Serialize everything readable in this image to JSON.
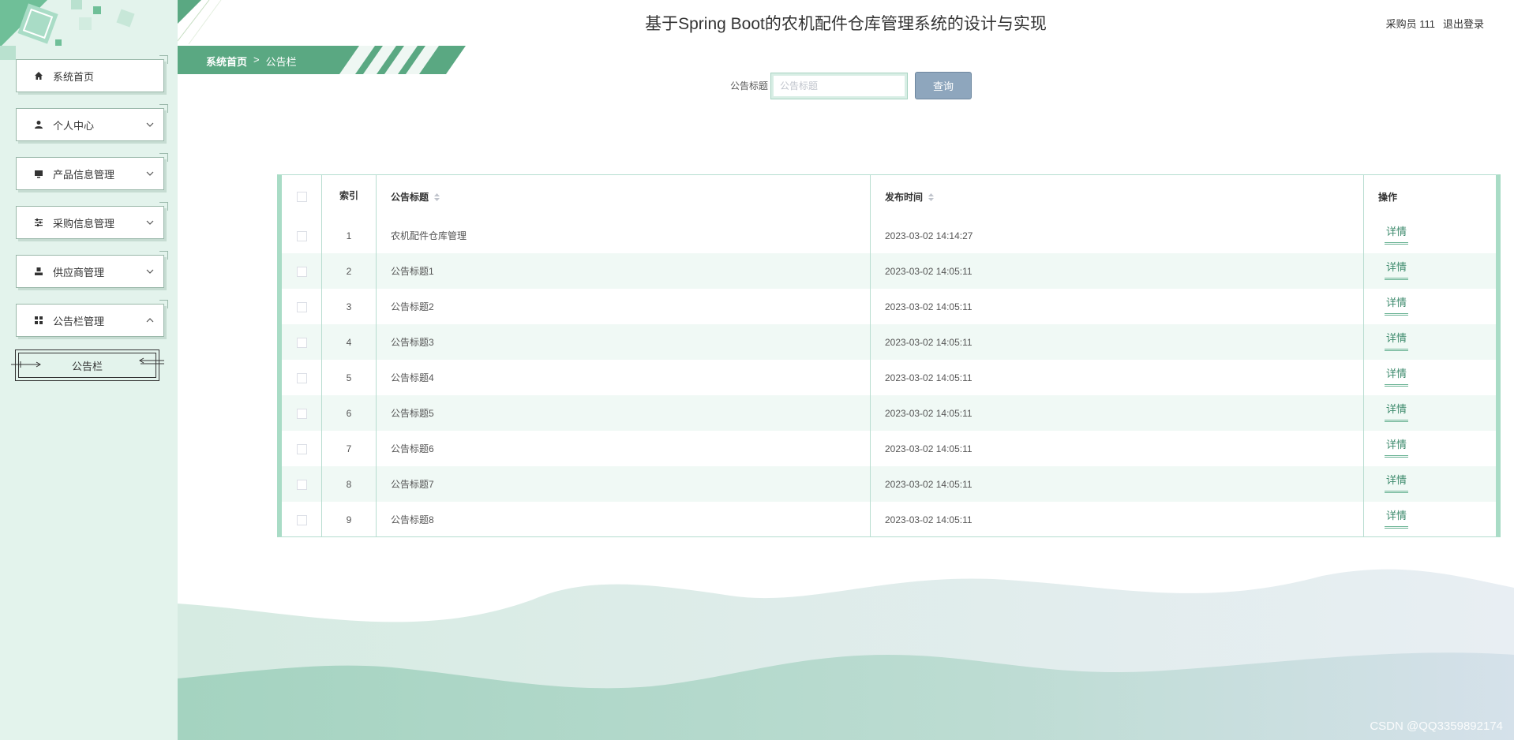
{
  "header": {
    "title": "基于Spring Boot的农机配件仓库管理系统的设计与实现",
    "user": "采购员 111",
    "logout": "退出登录"
  },
  "breadcrumb": {
    "home": "系统首页",
    "separator": ">",
    "current": "公告栏"
  },
  "sidebar": {
    "items": [
      {
        "label": "系统首页",
        "icon": "home-icon",
        "has_children": false
      },
      {
        "label": "个人中心",
        "icon": "user-icon",
        "has_children": true,
        "expanded": false
      },
      {
        "label": "产品信息管理",
        "icon": "monitor-icon",
        "has_children": true,
        "expanded": false
      },
      {
        "label": "采购信息管理",
        "icon": "sliders-icon",
        "has_children": true,
        "expanded": false
      },
      {
        "label": "供应商管理",
        "icon": "person-icon",
        "has_children": true,
        "expanded": false
      },
      {
        "label": "公告栏管理",
        "icon": "grid-icon",
        "has_children": true,
        "expanded": true
      }
    ],
    "submenu": {
      "label": "公告栏"
    }
  },
  "search": {
    "label": "公告标题",
    "placeholder": "公告标题",
    "value": "",
    "button": "查询"
  },
  "table": {
    "headers": {
      "index": "索引",
      "title": "公告标题",
      "time": "发布时间",
      "action": "操作"
    },
    "rows": [
      {
        "index": "1",
        "title": "农机配件仓库管理",
        "time": "2023-03-02 14:14:27",
        "action": "详情"
      },
      {
        "index": "2",
        "title": "公告标题1",
        "time": "2023-03-02 14:05:11",
        "action": "详情"
      },
      {
        "index": "3",
        "title": "公告标题2",
        "time": "2023-03-02 14:05:11",
        "action": "详情"
      },
      {
        "index": "4",
        "title": "公告标题3",
        "time": "2023-03-02 14:05:11",
        "action": "详情"
      },
      {
        "index": "5",
        "title": "公告标题4",
        "time": "2023-03-02 14:05:11",
        "action": "详情"
      },
      {
        "index": "6",
        "title": "公告标题5",
        "time": "2023-03-02 14:05:11",
        "action": "详情"
      },
      {
        "index": "7",
        "title": "公告标题6",
        "time": "2023-03-02 14:05:11",
        "action": "详情"
      },
      {
        "index": "8",
        "title": "公告标题7",
        "time": "2023-03-02 14:05:11",
        "action": "详情"
      },
      {
        "index": "9",
        "title": "公告标题8",
        "time": "2023-03-02 14:05:11",
        "action": "详情"
      }
    ]
  },
  "watermark": "CSDN @QQ3359892174",
  "colors": {
    "accent": "#5aa882",
    "sidebar_bg": "#e3f3ec",
    "button": "#8ea6bd",
    "link": "#3c8a6c"
  }
}
